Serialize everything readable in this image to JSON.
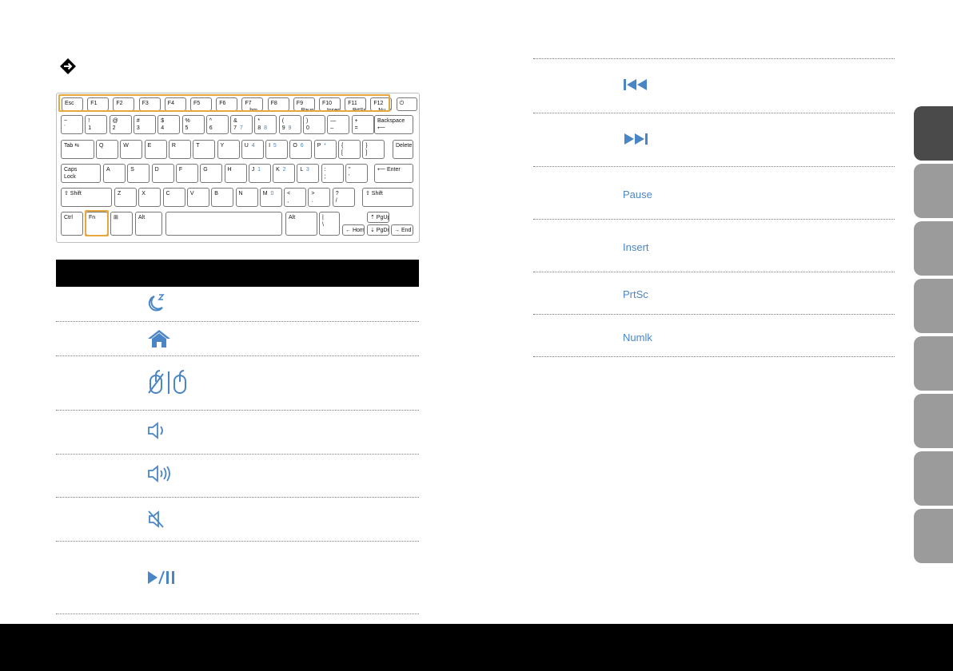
{
  "colors": {
    "accent": "#4a86c6",
    "highlight": "#e7a73d",
    "header_black": "#000000",
    "tab_dark": "#4a4a4a",
    "tab_light": "#9b9b9b"
  },
  "section_marker_icon": "arrow-diamond-icon",
  "keyboard": {
    "fn_row": [
      {
        "main": "Esc",
        "sub": ""
      },
      {
        "main": "F1",
        "sub": ""
      },
      {
        "main": "F2",
        "sub": ""
      },
      {
        "main": "F3",
        "sub": ""
      },
      {
        "main": "F4",
        "sub": ""
      },
      {
        "main": "F5",
        "sub": ""
      },
      {
        "main": "F6",
        "sub": ""
      },
      {
        "main": "F7",
        "sub": "hm"
      },
      {
        "main": "F8",
        "sub": ""
      },
      {
        "main": "F9",
        "sub": "Pause"
      },
      {
        "main": "F10",
        "sub": "Insert"
      },
      {
        "main": "F11",
        "sub": "PrtSc"
      },
      {
        "main": "F12",
        "sub": "Nu..mlk"
      },
      {
        "main": "⏻",
        "sub": ""
      }
    ],
    "row1": [
      "~\n`",
      "!\n1",
      "@\n2",
      "#\n3",
      "$\n4",
      "%\n5",
      "^\n6",
      "&\n7",
      "*\n8",
      "(\n9",
      ")\n0",
      "—\n–",
      "+\n=",
      "Backspace\n⟵"
    ],
    "row2": [
      "Tab ⇆",
      "Q",
      "W",
      "E",
      "R",
      "T",
      "Y",
      "U",
      "I",
      "O",
      "P",
      "{\n[",
      "}\n]",
      "Delete"
    ],
    "row3": [
      "Caps\nLock",
      "A",
      "S",
      "D",
      "F",
      "G",
      "H",
      "J",
      "K",
      "L",
      ":\n;",
      "\"\n'",
      "⟵ Enter"
    ],
    "row4": [
      "⇧ Shift",
      "Z",
      "X",
      "C",
      "V",
      "B",
      "N",
      "M",
      "<\n,",
      ">\n.",
      "?\n/",
      "⇧ Shift"
    ],
    "row5": [
      "Ctrl",
      "Fn",
      "⊞",
      "Alt",
      "",
      "Alt",
      "|\n\\",
      "← Home",
      "⇡ PgUp",
      "⇣ PgDn",
      "→ End"
    ],
    "secondary": {
      "U": "4",
      "I": "5",
      "O": "6",
      "P": "*",
      "J": "1",
      "K": "2",
      "L": "3",
      "M": "0",
      "&": "7",
      "*": "8",
      "(": "9"
    }
  },
  "left_table_icons": [
    "sleep-icon",
    "home-icon",
    "touchpad-toggle-icon",
    "volume-down-icon",
    "volume-up-icon",
    "mute-icon",
    "play-pause-icon"
  ],
  "right_table": {
    "icons": [
      "previous-track-icon",
      "next-track-icon"
    ],
    "labels": [
      "Pause",
      "Insert",
      "PrtSc",
      "Numlk"
    ]
  }
}
